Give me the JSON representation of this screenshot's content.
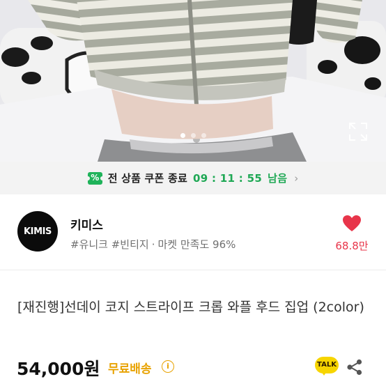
{
  "carousel": {
    "slide_count": 3,
    "active_index": 0,
    "expand_icon": "expand-icon",
    "colors": {
      "stripe_gray": "#a8ab9f",
      "stripe_cream": "#ecebe2",
      "background": "#e9e9ec"
    }
  },
  "coupon_bar": {
    "icon": "coupon-ticket-icon",
    "icon_mark": "%",
    "label": "전 상품 쿠폰 종료",
    "timer": "09 : 11 : 55",
    "suffix": "남음",
    "chevron": "›",
    "accent": "#1fa855"
  },
  "shop": {
    "logo_text": "KIMIS",
    "name": "키미스",
    "tags": "#유니크 #빈티지",
    "separator": "·",
    "satisfaction": "마켓 만족도 96%",
    "like_icon": "heart-icon",
    "like_count": "68.8만",
    "like_color": "#e8354a"
  },
  "product": {
    "title": "[재진행]선데이 코지 스트라이프 크롭 와플 후드 집업 (2color)",
    "price": "54,000원",
    "shipping": "무료배송",
    "info_icon_glyph": "i",
    "shipping_color": "#e8a200"
  },
  "actions": {
    "talk_label": "TALK",
    "talk_icon": "kakao-talk-icon",
    "share_icon": "share-icon"
  }
}
